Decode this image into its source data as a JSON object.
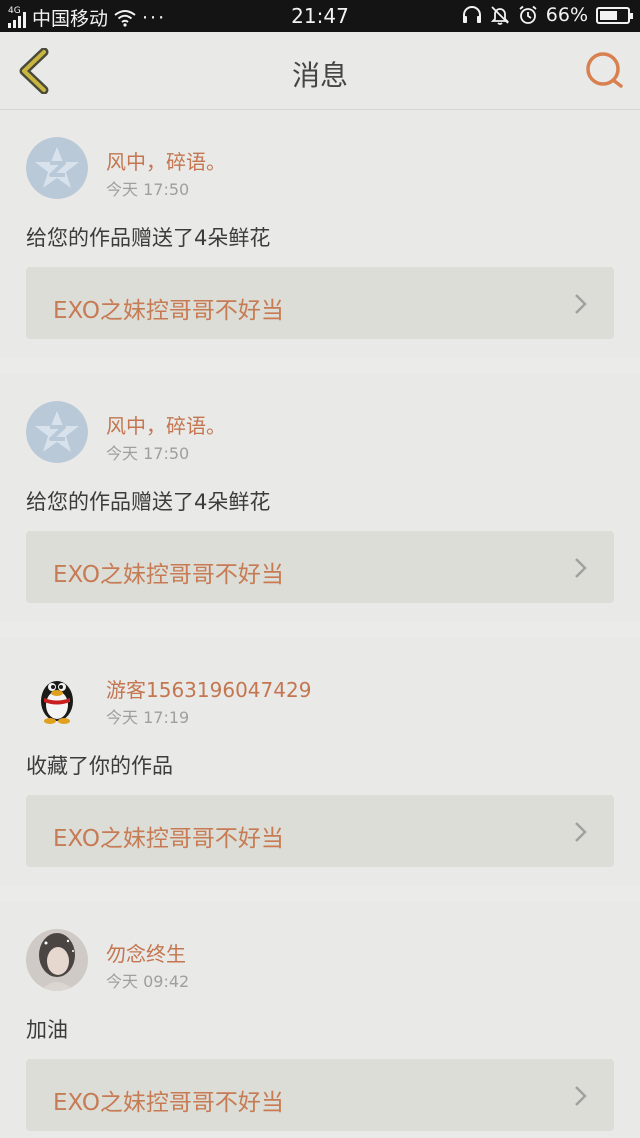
{
  "status_bar": {
    "network": "4G",
    "carrier": "中国移动",
    "more": "···",
    "time": "21:47",
    "battery_text": "66%",
    "battery_level": 0.66
  },
  "nav": {
    "title": "消息"
  },
  "colors": {
    "accent": "#c3764f",
    "background": "#ebebea",
    "link_card": "#dcddd6"
  },
  "messages": [
    {
      "user": "风中，碎语。",
      "time": "今天 17:50",
      "action": "给您的作品赠送了4朵鲜花",
      "work_title": "EXO之妹控哥哥不好当",
      "avatar": "qq-star-avatar"
    },
    {
      "user": "风中，碎语。",
      "time": "今天 17:50",
      "action": "给您的作品赠送了4朵鲜花",
      "work_title": "EXO之妹控哥哥不好当",
      "avatar": "qq-star-avatar"
    },
    {
      "user": "游客1563196047429",
      "time": "今天 17:19",
      "action": "收藏了你的作品",
      "work_title": "EXO之妹控哥哥不好当",
      "avatar": "qq-penguin-avatar"
    },
    {
      "user": "勿念终生",
      "time": "今天 09:42",
      "action": "加油",
      "work_title": "EXO之妹控哥哥不好当",
      "avatar": "photo-avatar"
    }
  ]
}
